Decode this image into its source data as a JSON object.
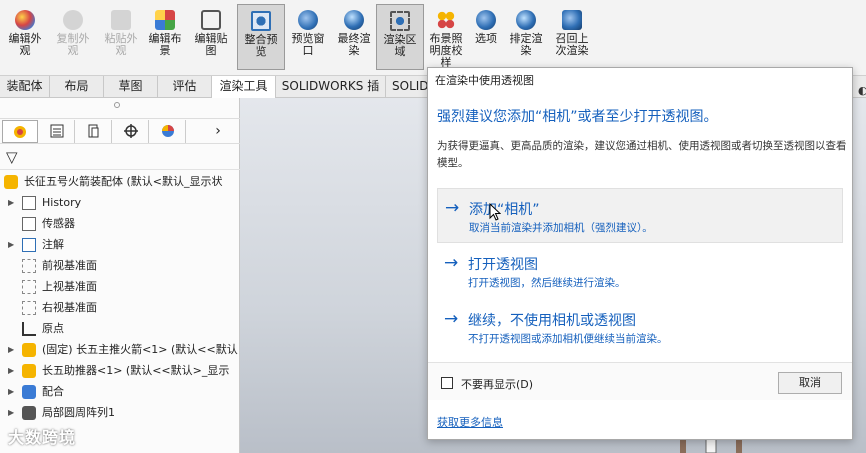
{
  "ribbon": {
    "buttons": [
      {
        "label": "编辑外\n观",
        "state": "normal",
        "icon": "appearance-icon"
      },
      {
        "label": "复制外\n观",
        "state": "disabled",
        "icon": "copy-appearance-icon"
      },
      {
        "label": "粘贴外\n观",
        "state": "disabled",
        "icon": "paste-appearance-icon"
      },
      {
        "label": "编辑布\n景",
        "state": "normal",
        "icon": "scene-icon"
      },
      {
        "label": "编辑贴\n图",
        "state": "normal",
        "icon": "decal-icon"
      },
      {
        "label": "整合预\n览",
        "state": "active",
        "icon": "integrated-preview-icon"
      },
      {
        "label": "预览窗\n口",
        "state": "normal",
        "icon": "preview-window-icon"
      },
      {
        "label": "最终渲\n染",
        "state": "normal",
        "icon": "final-render-icon"
      },
      {
        "label": "渲染区\n域",
        "state": "active",
        "icon": "render-region-icon"
      },
      {
        "label": "布景照\n明度校\n样",
        "state": "normal",
        "icon": "scene-illumination-icon"
      },
      {
        "label": "选项",
        "state": "normal",
        "icon": "options-icon"
      },
      {
        "label": "排定渲\n染",
        "state": "normal",
        "icon": "schedule-render-icon"
      },
      {
        "label": "召回上\n次渲染",
        "state": "normal",
        "icon": "recall-last-render-icon"
      }
    ]
  },
  "tabs": [
    {
      "label": "装配体"
    },
    {
      "label": "布局"
    },
    {
      "label": "草图"
    },
    {
      "label": "评估"
    },
    {
      "label": "渲染工具",
      "active": true
    },
    {
      "label": "SOLIDWORKS 插件"
    },
    {
      "label": "SOLID"
    }
  ],
  "feature_manager": {
    "tab_icons": [
      "feature-tree-icon",
      "property-manager-icon",
      "configuration-manager-icon",
      "dimxpert-icon",
      "display-manager-icon"
    ],
    "more_arrow": "›",
    "filter_glyph": "▽",
    "tree": [
      {
        "label": "长征五号火箭装配体  (默认<默认_显示状",
        "icon": "assembly-icon",
        "expander": "",
        "indent": 0
      },
      {
        "label": "History",
        "icon": "history-icon",
        "expander": "▶",
        "indent": 1
      },
      {
        "label": "传感器",
        "icon": "sensor-icon",
        "expander": "",
        "indent": 1
      },
      {
        "label": "注解",
        "icon": "annotation-icon",
        "expander": "▶",
        "indent": 1
      },
      {
        "label": "前视基准面",
        "icon": "plane-icon",
        "expander": "",
        "indent": 1
      },
      {
        "label": "上视基准面",
        "icon": "plane-icon",
        "expander": "",
        "indent": 1
      },
      {
        "label": "右视基准面",
        "icon": "plane-icon",
        "expander": "",
        "indent": 1
      },
      {
        "label": "原点",
        "icon": "origin-icon",
        "expander": "",
        "indent": 1
      },
      {
        "label": "(固定) 长五主推火箭<1> (默认<<默认",
        "icon": "part-icon",
        "expander": "▶",
        "indent": 1
      },
      {
        "label": "长五助推器<1> (默认<<默认>_显示",
        "icon": "part-icon",
        "expander": "▶",
        "indent": 1
      },
      {
        "label": "配合",
        "icon": "mates-icon",
        "expander": "▶",
        "indent": 1
      },
      {
        "label": "局部圆周阵列1",
        "icon": "pattern-icon",
        "expander": "▶",
        "indent": 1
      }
    ]
  },
  "watermark": "大数跨境",
  "popup": {
    "title": "在渲染中使用透视图",
    "heading": "强烈建议您添加“相机”或者至少打开透视图。",
    "description": "为获得更逼真、更高品质的渲染，建议您通过相机、使用透视图或者切换至透视图以查看模型。",
    "options": [
      {
        "arrow": "→",
        "title": "添加“相机”",
        "subtitle": "取消当前渲染并添加相机（强烈建议）。",
        "highlighted": true
      },
      {
        "arrow": "→",
        "title": "打开透视图",
        "subtitle": "打开透视图，然后继续进行渲染。",
        "highlighted": false
      },
      {
        "arrow": "→",
        "title": "继续，不使用相机或透视图",
        "subtitle": "不打开透视图或添加相机便继续当前渲染。",
        "highlighted": false
      }
    ],
    "dont_show_label": "不要再显示(D)",
    "cancel_label": "取消",
    "more_info": "获取更多信息"
  }
}
